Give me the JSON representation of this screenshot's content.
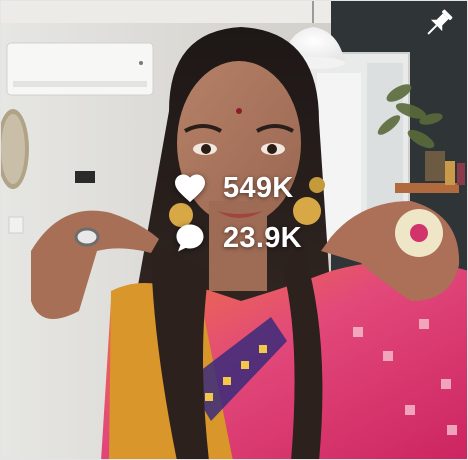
{
  "post": {
    "likes": "549K",
    "comments": "23.9K"
  },
  "icons": {
    "pin": "pin-icon",
    "likes": "heart-icon",
    "comments": "comment-bubble-icon"
  },
  "colors": {
    "overlay_text": "#ffffff",
    "wall": "#d9d8d3",
    "dark_wall": "#2e3336",
    "saree_pink": "#d92e6a",
    "saree_orange": "#ee6f2d",
    "blouse_gold": "#d79a2b"
  }
}
